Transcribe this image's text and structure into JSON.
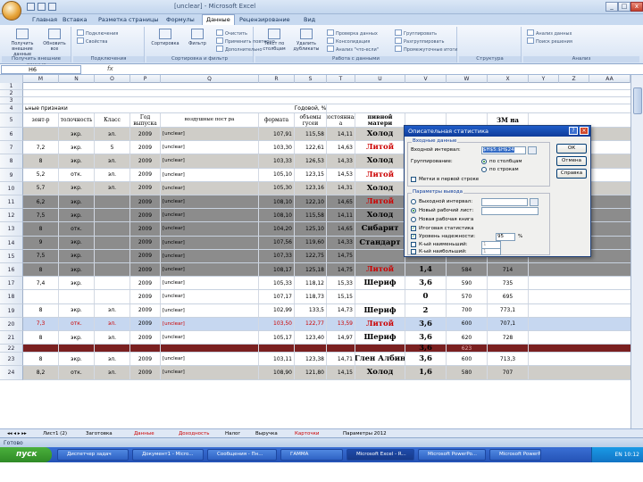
{
  "window": {
    "title": "[unclear] - Microsoft Excel"
  },
  "ribbon": {
    "tabs": [
      "Главная",
      "Вставка",
      "Разметка страницы",
      "Формулы",
      "Данные",
      "Рецензирование",
      "Вид"
    ],
    "active_tab": "Данные",
    "groups": [
      "Получить внешние данные",
      "Подключения",
      "Сортировка и фильтр",
      "Работа с данными",
      "Структура",
      "Анализ"
    ],
    "buttons": {
      "get_external": "Получить внешние данные",
      "refresh_all": "Обновить все",
      "connections": "Подключения",
      "properties": "Свойства",
      "sort": "Сортировка",
      "filter": "Фильтр",
      "clear": "Очистить",
      "reapply": "Применить повторно",
      "advanced": "Дополнительно",
      "text_to_columns": "Текст по столбцам",
      "remove_duplicates": "Удалить дубликаты",
      "data_validation": "Проверка данных",
      "consolidate": "Консолидация",
      "what_if": "Анализ \"что-если\"",
      "group": "Группировать",
      "ungroup": "Разгруппировать",
      "subtotal": "Промежуточные итоги",
      "data_analysis": "Анализ данных",
      "solver": "Поиск решения"
    }
  },
  "formula_bar": {
    "name_box": "H6",
    "fx": "fx",
    "content": ""
  },
  "columns": [
    "M",
    "N",
    "O",
    "P",
    "Q",
    "R",
    "S",
    "T",
    "U",
    "V",
    "W",
    "X",
    "Y",
    "Z",
    "AA"
  ],
  "row_numbers": [
    "1",
    "2",
    "3",
    "4",
    "5",
    "6",
    "7",
    "8",
    "9",
    "10",
    "11",
    "12",
    "13",
    "14",
    "15",
    "16",
    "17",
    "18",
    "19",
    "20",
    "21",
    "22",
    "23",
    "24"
  ],
  "table_header": {
    "title": "ьные признаки",
    "col_m": "зонт-р",
    "col_n": "толочность",
    "col_o": "Класс",
    "col_p": "Год выпуска",
    "col_q": "воздушные пост ра",
    "col_r": "формата",
    "col_s_top": "Годовой, %",
    "col_s": "объемы гусеи",
    "col_t": "постоянная а",
    "col_u": "пивной матери",
    "col_x": "ЗМ на"
  },
  "rows": [
    {
      "m": "",
      "n": "экр.",
      "o": "эл.",
      "p": "2009",
      "q": "[unclear]",
      "r": "107,91",
      "s": "115,58",
      "t": "14,11",
      "u": "Холод",
      "v": "",
      "w": "",
      "x": "",
      "shade": "gray"
    },
    {
      "m": "7,2",
      "n": "экр.",
      "o": "5",
      "p": "2009",
      "q": "[unclear]",
      "r": "103,30",
      "s": "122,61",
      "t": "14,63",
      "u": "Литой",
      "v": "",
      "w": "",
      "x": "",
      "shade": "white"
    },
    {
      "m": "8",
      "n": "экр.",
      "o": "эл.",
      "p": "2009",
      "q": "[unclear]",
      "r": "103,33",
      "s": "126,53",
      "t": "14,33",
      "u": "Холод",
      "v": "",
      "w": "",
      "x": "",
      "shade": "gray"
    },
    {
      "m": "5,2",
      "n": "отк.",
      "o": "эл.",
      "p": "2009",
      "q": "[unclear]",
      "r": "105,10",
      "s": "123,15",
      "t": "14,53",
      "u": "Литой",
      "v": "",
      "w": "",
      "x": "",
      "shade": "white"
    },
    {
      "m": "5,7",
      "n": "экр.",
      "o": "эл.",
      "p": "2009",
      "q": "[unclear]",
      "r": "105,30",
      "s": "123,16",
      "t": "14,31",
      "u": "Холод",
      "v": "",
      "w": "",
      "x": "",
      "shade": "gray"
    },
    {
      "m": "6,2",
      "n": "экр.",
      "o": "",
      "p": "2009",
      "q": "[unclear]",
      "r": "108,10",
      "s": "122,10",
      "t": "14,65",
      "u": "Литой",
      "v": "",
      "w": "",
      "x": "",
      "shade": "dark"
    },
    {
      "m": "7,5",
      "n": "экр.",
      "o": "",
      "p": "2009",
      "q": "[unclear]",
      "r": "108,10",
      "s": "115,58",
      "t": "14,11",
      "u": "Холод",
      "v": "",
      "w": "",
      "x": "",
      "shade": "dark"
    },
    {
      "m": "8",
      "n": "отк.",
      "o": "",
      "p": "2009",
      "q": "[unclear]",
      "r": "104,20",
      "s": "125,10",
      "t": "14,65",
      "u": "Сибарит",
      "v": "",
      "w": "",
      "x": "",
      "shade": "dark"
    },
    {
      "m": "9",
      "n": "экр.",
      "o": "",
      "p": "2009",
      "q": "[unclear]",
      "r": "107,56",
      "s": "119,60",
      "t": "14,33",
      "u": "Стандарт",
      "v": "",
      "w": "",
      "x": "",
      "shade": "dark"
    },
    {
      "m": "7,5",
      "n": "экр.",
      "o": "",
      "p": "2009",
      "q": "[unclear]",
      "r": "107,33",
      "s": "122,75",
      "t": "14,75",
      "u": "",
      "v": "",
      "w": "",
      "x": "",
      "shade": "dark"
    },
    {
      "m": "8",
      "n": "экр.",
      "o": "",
      "p": "2009",
      "q": "[unclear]",
      "r": "108,17",
      "s": "125,18",
      "t": "14,75",
      "u": "Литой",
      "v": "1,4",
      "w": "584",
      "x": "714",
      "shade": "dark"
    },
    {
      "m": "7,4",
      "n": "экр.",
      "o": "",
      "p": "2009",
      "q": "[unclear]",
      "r": "105,33",
      "s": "118,12",
      "t": "15,33",
      "u": "Шериф",
      "v": "3,6",
      "w": "590",
      "x": "735",
      "shade": "white"
    },
    {
      "m": "",
      "n": "",
      "o": "",
      "p": "2009",
      "q": "[unclear]",
      "r": "107,17",
      "s": "118,73",
      "t": "15,15",
      "u": "",
      "v": "0",
      "w": "570",
      "x": "695",
      "shade": "white"
    },
    {
      "m": "8",
      "n": "экр.",
      "o": "эл.",
      "p": "2009",
      "q": "[unclear]",
      "r": "102,99",
      "s": "133,5",
      "t": "14,73",
      "u": "Шериф",
      "v": "2",
      "w": "700",
      "x": "773,1",
      "shade": "white"
    },
    {
      "m": "7,3",
      "n": "отк.",
      "o": "эл.",
      "p": "2009",
      "q": "[unclear]",
      "r": "103,50",
      "s": "122,77",
      "t": "13,59",
      "u": "Литой",
      "v": "3,6",
      "w": "600",
      "x": "707,1",
      "shade": "blue"
    },
    {
      "m": "8",
      "n": "экр.",
      "o": "эл.",
      "p": "2009",
      "q": "[unclear]",
      "r": "105,17",
      "s": "123,40",
      "t": "14,97",
      "u": "Шериф",
      "v": "3,6",
      "w": "620",
      "x": "728",
      "shade": "white"
    },
    {
      "m": "",
      "n": "",
      "o": "",
      "p": "",
      "q": "",
      "r": "",
      "s": "",
      "t": "",
      "u": "",
      "v": "3,6",
      "w": "623",
      "x": "",
      "shade": "maroon"
    },
    {
      "m": "8",
      "n": "экр.",
      "o": "эл.",
      "p": "2009",
      "q": "[unclear]",
      "r": "103,11",
      "s": "123,38",
      "t": "14,71",
      "u": "Глен Албин",
      "v": "3,6",
      "w": "600",
      "x": "713,3",
      "shade": "white"
    },
    {
      "m": "8,2",
      "n": "отк.",
      "o": "эл.",
      "p": "2009",
      "q": "[unclear]",
      "r": "108,90",
      "s": "121,80",
      "t": "14,15",
      "u": "Холод",
      "v": "1,6",
      "w": "580",
      "x": "707",
      "shade": "gray"
    }
  ],
  "dialog": {
    "title": "Описательная статистика",
    "input_section": "Входные данные",
    "input_range_label": "Входной интервал:",
    "input_range_value": "$H$5:$H$24",
    "grouping_label": "Группирование:",
    "by_columns": "по столбцам",
    "by_rows": "по строкам",
    "labels_first_row": "Метки в первой строке",
    "output_section": "Параметры вывода",
    "output_range": "Выходной интервал:",
    "new_sheet": "Новый рабочий лист:",
    "new_workbook": "Новая рабочая книга",
    "summary_stats": "Итоговая статистика",
    "confidence_level": "Уровень надежности:",
    "confidence_value": "95",
    "percent": "%",
    "kth_smallest": "К-ый наименьший:",
    "kth_smallest_value": "1",
    "kth_largest": "К-ый наибольший:",
    "kth_largest_value": "1",
    "ok": "ОК",
    "cancel": "Отмена",
    "help": "Справка"
  },
  "sheet_tabs": [
    "Лист1 (2)",
    "Заготовка",
    "Данные",
    "Доходность",
    "Налог",
    "Выручка",
    "Карточки",
    "Параметры 2012"
  ],
  "active_sheet": "Доходность",
  "status": "Готово",
  "taskbar": {
    "start": "пуск",
    "items": [
      "Диспетчер задач",
      "Документ1 - Micro...",
      "Сообщения - Пн...",
      "ГАММА",
      "Microsoft Excel - R...",
      "Microsoft PowerPo...",
      "Microsoft PowerP..."
    ],
    "lang": "EN",
    "clock": "10:12"
  }
}
